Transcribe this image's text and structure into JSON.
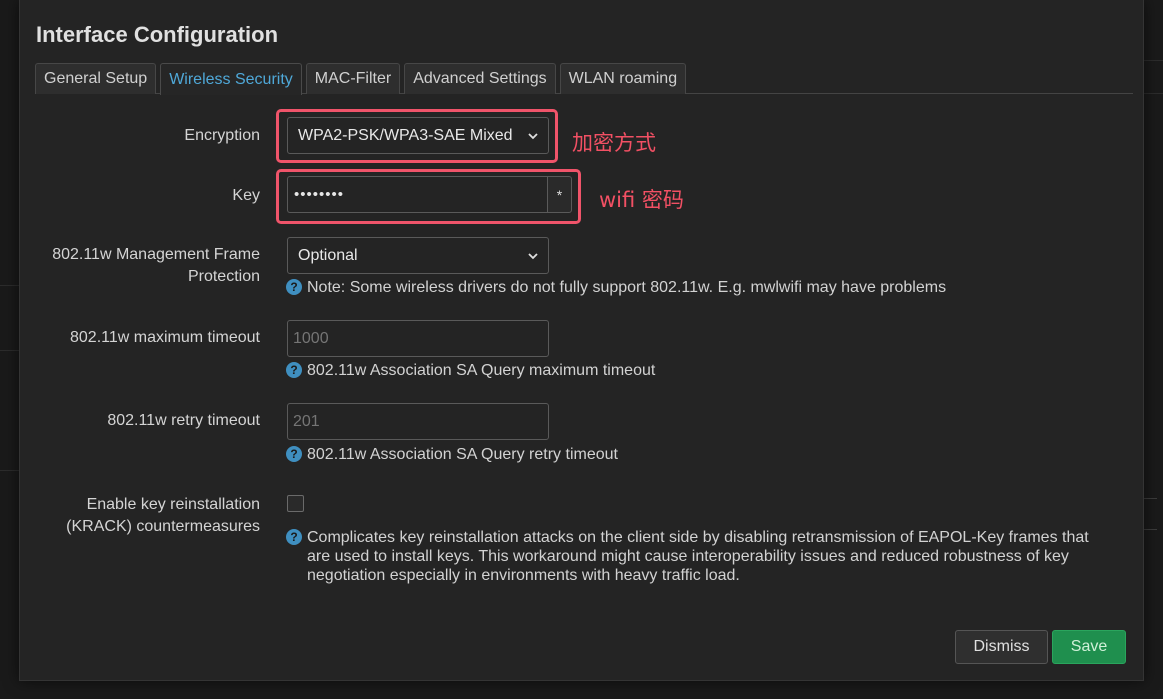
{
  "modal": {
    "title": "Interface Configuration"
  },
  "tabs": [
    {
      "label": "General Setup",
      "active": false
    },
    {
      "label": "Wireless Security",
      "active": true
    },
    {
      "label": "MAC-Filter",
      "active": false
    },
    {
      "label": "Advanced Settings",
      "active": false
    },
    {
      "label": "WLAN roaming",
      "active": false
    }
  ],
  "form": {
    "encryption": {
      "label": "Encryption",
      "value": "WPA2-PSK/WPA3-SAE Mixed"
    },
    "key": {
      "label": "Key",
      "value": "••••••••",
      "toggle": "*"
    },
    "mfp": {
      "label_line1": "802.11w Management Frame",
      "label_line2": "Protection",
      "value": "Optional",
      "help": "Note: Some wireless drivers do not fully support 802.11w. E.g. mwlwifi may have problems"
    },
    "max_timeout": {
      "label": "802.11w maximum timeout",
      "placeholder": "1000",
      "help": "802.11w Association SA Query maximum timeout"
    },
    "retry_timeout": {
      "label": "802.11w retry timeout",
      "placeholder": "201",
      "help": "802.11w Association SA Query retry timeout"
    },
    "krack": {
      "label_line1": "Enable key reinstallation",
      "label_line2": "(KRACK) countermeasures",
      "checked": false,
      "help_line1": "Complicates key reinstallation attacks on the client side by disabling retransmission of EAPOL-Key frames that",
      "help_line2": "are used to install keys. This workaround might cause interoperability issues and reduced robustness of key",
      "help_line3": "negotiation especially in environments with heavy traffic load."
    }
  },
  "annotations": {
    "encryption_note": "加密方式",
    "key_note": "wifi 密码"
  },
  "buttons": {
    "dismiss": "Dismiss",
    "save": "Save"
  },
  "colors": {
    "accent_tab": "#4fa8d8",
    "save": "#1f8f4e",
    "annotation": "#f25064"
  },
  "icons": {
    "help": "help-icon",
    "chevron": "chevron-down-icon"
  }
}
